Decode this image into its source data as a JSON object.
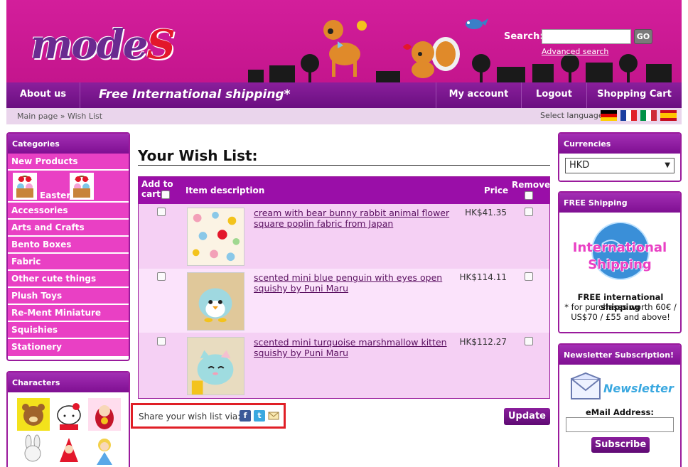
{
  "header": {
    "logo_text": "modeS",
    "search_label": "Search:",
    "search_value": "",
    "go_label": "GO",
    "advanced_search": "Advanced search"
  },
  "nav": {
    "about": "About us",
    "promo": "Free International shipping*",
    "account": "My account",
    "logout": "Logout",
    "cart": "Shopping Cart"
  },
  "breadcrumb": "Main page » Wish List",
  "language": {
    "label": "Select language:",
    "flags": [
      "de-flag-icon",
      "fr-flag-icon",
      "it-flag-icon",
      "es-flag-icon"
    ]
  },
  "categories": {
    "title": "Categories",
    "new_products": "New Products",
    "easter": "Easter",
    "items": [
      "Accessories",
      "Arts and Crafts",
      "Bento Boxes",
      "Fabric",
      "Other cute things",
      "Plush Toys",
      "Re-Ment Miniature",
      "Squishies",
      "Stationery"
    ]
  },
  "characters": {
    "title": "Characters"
  },
  "wishlist": {
    "title": "Your Wish List:",
    "col_add": "Add to cart",
    "col_desc": "Item description",
    "col_price": "Price",
    "col_remove": "Remove",
    "items": [
      {
        "name": "cream with bear bunny rabbit animal flower square poplin fabric from Japan",
        "price": "HK$41.35"
      },
      {
        "name": "scented mini blue penguin with eyes open squishy by Puni Maru",
        "price": "HK$114.11"
      },
      {
        "name": "scented mini turquoise marshmallow kitten squishy by Puni Maru",
        "price": "HK$112.27"
      }
    ],
    "share_label": "Share your wish list via:",
    "update_label": "Update"
  },
  "currencies": {
    "title": "Currencies",
    "selected": "HKD"
  },
  "shipping": {
    "title": "FREE Shipping",
    "banner_line1": "International",
    "banner_line2": "Shipping",
    "text_main": "FREE international shipping",
    "text_detail": "* for purchases worth 60€ / US$70 / £55 and above!"
  },
  "newsletter": {
    "title": "Newsletter Subscription!",
    "banner": "Newsletter",
    "email_label": "eMail Address:",
    "email_value": "",
    "subscribe_label": "Subscribe"
  },
  "colors": {
    "header_pink": "#c4158d",
    "nav_purple": "#7a1590",
    "category_pink": "#e940c4",
    "table_bg": "#f5d0f4",
    "highlight_red": "#e01f26"
  }
}
